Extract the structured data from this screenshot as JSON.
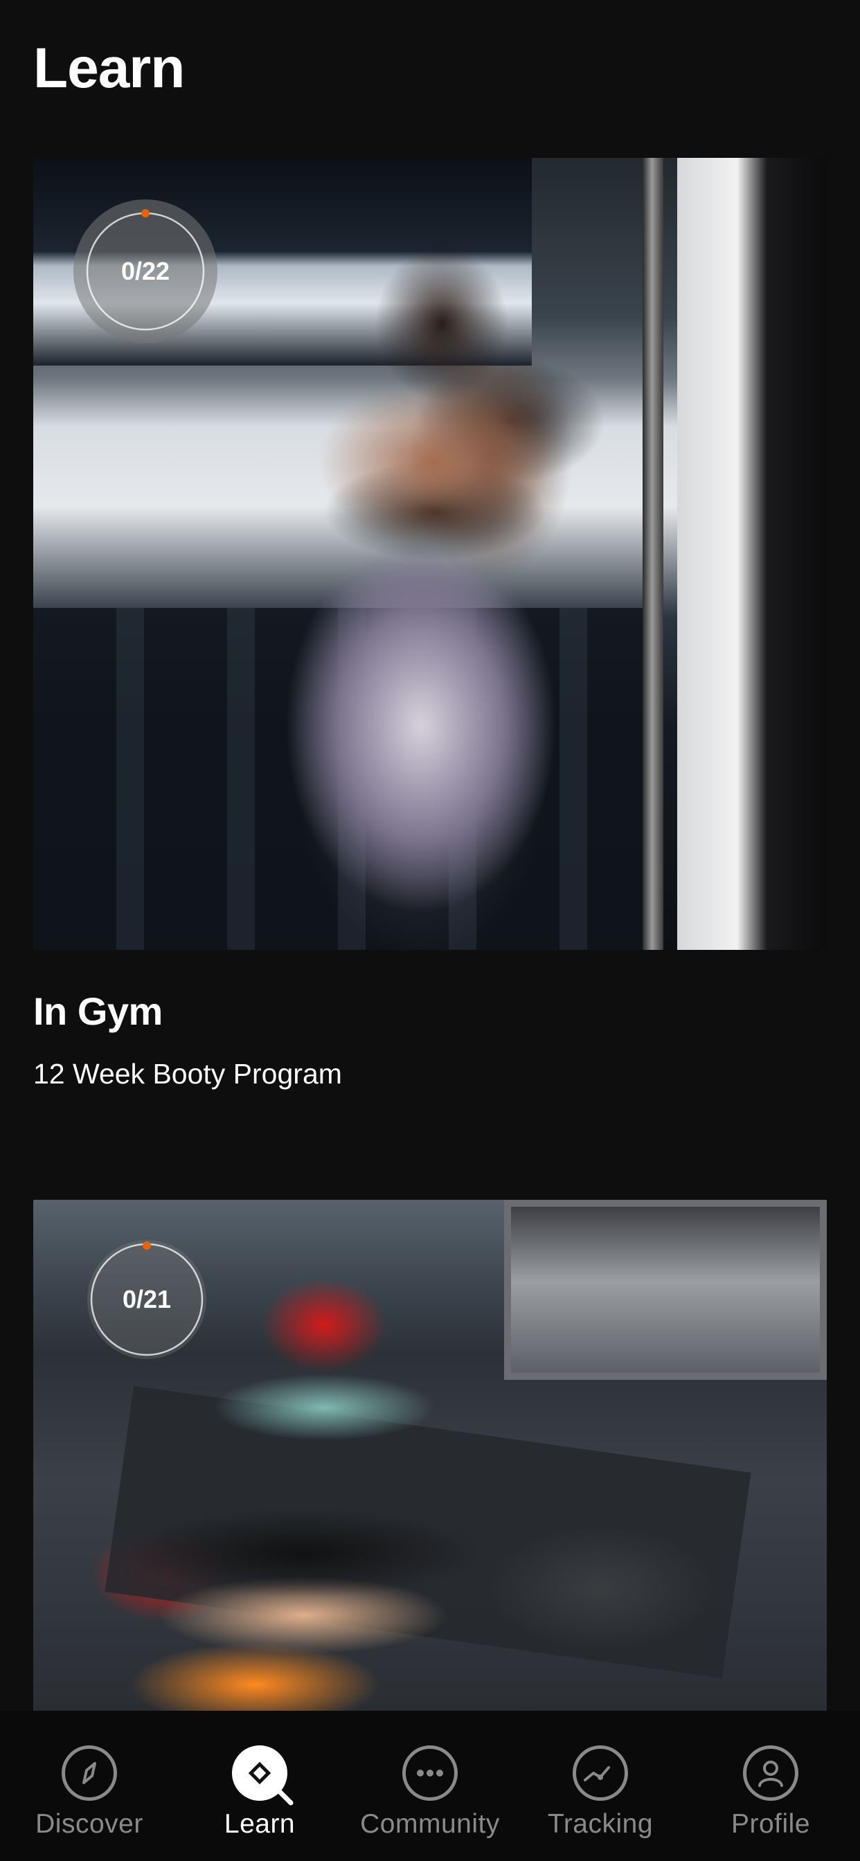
{
  "page": {
    "title": "Learn"
  },
  "programs": [
    {
      "title": "In Gym",
      "subtitle": "12 Week Booty Program",
      "progress": "0/22",
      "progress_fraction": 0
    },
    {
      "title": "",
      "subtitle": "",
      "progress": "0/21",
      "progress_fraction": 0
    }
  ],
  "colors": {
    "background": "#0e0e0f",
    "accent": "#e8620c",
    "tab_inactive": "#8a8a8a",
    "tab_active": "#ffffff"
  },
  "tabs": [
    {
      "label": "Discover",
      "icon": "compass-icon",
      "active": false
    },
    {
      "label": "Learn",
      "icon": "learn-search-icon",
      "active": true
    },
    {
      "label": "Community",
      "icon": "chat-bubble-icon",
      "active": false
    },
    {
      "label": "Tracking",
      "icon": "trend-chart-icon",
      "active": false
    },
    {
      "label": "Profile",
      "icon": "user-icon",
      "active": false
    }
  ]
}
